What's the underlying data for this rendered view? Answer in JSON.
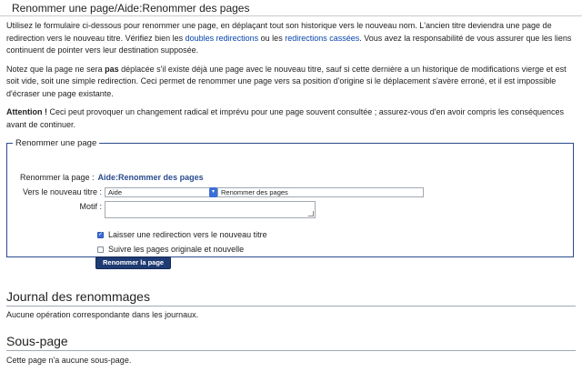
{
  "header": {
    "title": "Renommer une page/Aide:Renommer des pages"
  },
  "intro": {
    "p1_part1": "Utilisez le formulaire ci-dessous pour renommer une page, en déplaçant tout son historique vers le nouveau nom. L'ancien titre deviendra une page de redirection vers le nouveau titre. Vérifiez bien les ",
    "p1_link1": "doubles redirections",
    "p1_mid": " ou les ",
    "p1_link2": "redirections cassées",
    "p1_part2": ". Vous avez la responsabilité de vous assurer que les liens continuent de pointer vers leur destination supposée.",
    "p2_part1": "Notez que la page ne sera ",
    "p2_bold": "pas",
    "p2_part2": " déplacée s'il existe déjà une page avec le nouveau titre, sauf si cette dernière a un historique de modifications vierge et est soit vide, soit une simple redirection. Ceci permet de renommer une page vers sa position d'origine si le déplacement s'avère erroné, et il est impossible d'écraser une page existante.",
    "p3_bold": "Attention !",
    "p3_text": " Ceci peut provoquer un changement radical et imprévu pour une page souvent consultée ; assurez-vous d'en avoir compris les conséquences avant de continuer."
  },
  "form": {
    "legend": "Renommer une page",
    "rename_label": "Renommer la page :",
    "current_page": "Aide:Renommer des pages",
    "new_title_label": "Vers le nouveau titre :",
    "namespace_value": "Aide",
    "title_value": "Renommer des pages",
    "reason_label": "Motif :",
    "reason_value": "",
    "cb_redirect_label": "Laisser une redirection vers le nouveau titre",
    "cb_redirect_checked": true,
    "cb_watch_label": "Suivre les pages originale et nouvelle",
    "cb_watch_checked": false,
    "submit_label": "Renommer la page"
  },
  "log_section": {
    "heading": "Journal des renommages",
    "text": "Aucune opération correspondante dans les journaux."
  },
  "subpage_section": {
    "heading": "Sous-page",
    "text": "Cette page n'a aucune sous-page."
  }
}
